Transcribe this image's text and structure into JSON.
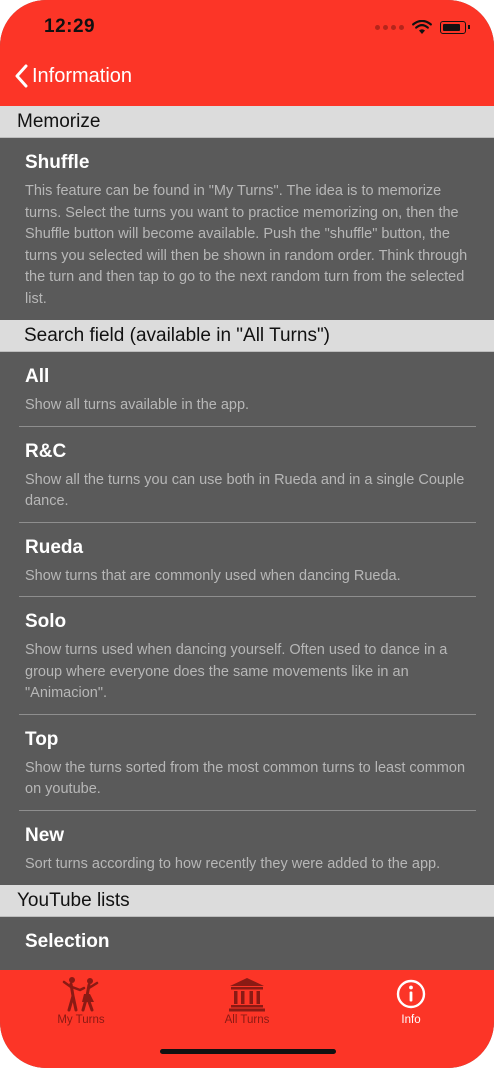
{
  "status_bar": {
    "time": "12:29"
  },
  "nav": {
    "back_label": "Information"
  },
  "sections": [
    {
      "header": "Memorize",
      "rows": [
        {
          "title": "Shuffle",
          "desc": "This feature can be found in \"My Turns\". The idea is to memorize turns. Select the turns you want to practice memorizing on, then the Shuffle button will become available. Push the \"shuffle\" button, the turns you selected will then be shown in random order. Think through the turn and then tap to go to the next random turn from the selected list."
        }
      ]
    },
    {
      "header": "Search field (available in \"All Turns\")",
      "rows": [
        {
          "title": "All",
          "desc": "Show all turns available in the app."
        },
        {
          "title": "R&C",
          "desc": "Show all the turns you can use both in Rueda and in a single Couple dance."
        },
        {
          "title": "Rueda",
          "desc": "Show turns that are commonly used when dancing Rueda."
        },
        {
          "title": "Solo",
          "desc": "Show turns used when dancing yourself. Often used to dance in a group where everyone does the same movements like in an \"Animacion\"."
        },
        {
          "title": "Top",
          "desc": "Show the turns sorted from the most common turns to least common on youtube."
        },
        {
          "title": "New",
          "desc": "Sort turns according to how recently they were added to the app."
        }
      ]
    },
    {
      "header": "YouTube lists",
      "rows": [
        {
          "title": "Selection",
          "desc": ""
        }
      ]
    }
  ],
  "tabs": [
    {
      "label": "My Turns",
      "icon": "dancers-icon",
      "active": false
    },
    {
      "label": "All Turns",
      "icon": "bank-icon",
      "active": false
    },
    {
      "label": "Info",
      "icon": "info-circle-icon",
      "active": true
    }
  ],
  "colors": {
    "accent": "#fc3527",
    "content_bg": "#5a5a5a",
    "section_header_bg": "#dcdcdc",
    "inactive_tab": "#8a1a14"
  }
}
